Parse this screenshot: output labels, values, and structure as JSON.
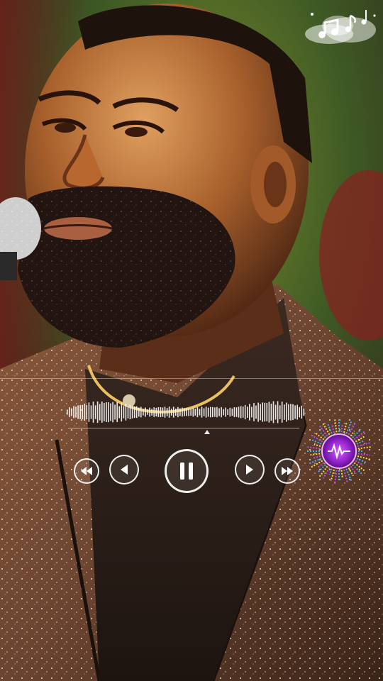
{
  "player": {
    "is_playing": true,
    "progress": 0.6,
    "controls": [
      "rewind",
      "previous",
      "pause",
      "next",
      "fast-forward"
    ]
  },
  "decor": {
    "music_notes_icon": "music-notes-icon",
    "visualizer_icon": "audio-visualizer-icon"
  },
  "colors": {
    "accent_purple": "#b84dff",
    "accent_blue": "#3ab4ff",
    "accent_yellow": "#ffd84a",
    "control_white": "#ffffff"
  }
}
